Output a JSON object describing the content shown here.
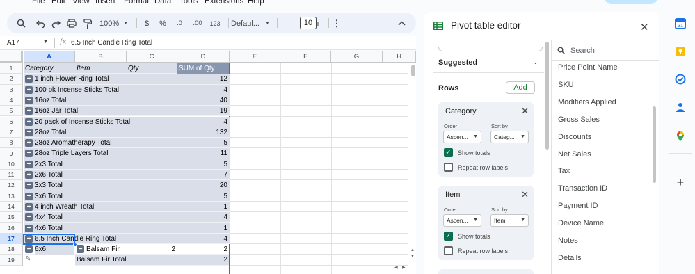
{
  "menu": [
    "File",
    "Edit",
    "View",
    "Insert",
    "Format",
    "Data",
    "Tools",
    "Extensions",
    "Help"
  ],
  "toolbar": {
    "zoom": "100%",
    "currency": "$",
    "percent": "%",
    "dec_decrease": ".0",
    "dec_increase": ".00",
    "number_format": "123",
    "font": "Defaul...",
    "font_size": "10",
    "minus": "–",
    "plus": "+"
  },
  "formula_bar": {
    "cell_ref": "A17",
    "fx": "fx",
    "content": "6.5 Inch Candle Ring Total"
  },
  "columns": [
    "A",
    "B",
    "C",
    "D",
    "E",
    "F",
    "G",
    "H"
  ],
  "row_numbers": [
    "1",
    "2",
    "3",
    "4",
    "5",
    "6",
    "7",
    "8",
    "9",
    "10",
    "11",
    "12",
    "13",
    "14",
    "15",
    "16",
    "17",
    "18",
    "19"
  ],
  "header_row": {
    "category": "Category",
    "item": "Item",
    "qty": "Qty",
    "sum": "SUM of Qty"
  },
  "rows": [
    {
      "label": "1 inch Flower Ring Total",
      "value": "12"
    },
    {
      "label": "100 pk Incense Sticks Total",
      "value": "4"
    },
    {
      "label": "16oz Total",
      "value": "40"
    },
    {
      "label": "16oz Jar Total",
      "value": "19"
    },
    {
      "label": "20 pack of Incense Sticks Total",
      "value": "4"
    },
    {
      "label": "28oz Total",
      "value": "132"
    },
    {
      "label": "28oz Aromatherapy Total",
      "value": "5"
    },
    {
      "label": "28oz Triple Layers Total",
      "value": "11"
    },
    {
      "label": "2x3 Total",
      "value": "5"
    },
    {
      "label": "2x6 Total",
      "value": "7"
    },
    {
      "label": "3x3 Total",
      "value": "20"
    },
    {
      "label": "3x6 Total",
      "value": "5"
    },
    {
      "label": "4 inch Wreath Total",
      "value": "1"
    },
    {
      "label": "4x4 Total",
      "value": "4"
    },
    {
      "label": "4x6 Total",
      "value": "1"
    },
    {
      "label": "6.5 Inch Candle Ring Total",
      "value": "4"
    }
  ],
  "row18": {
    "category": "6x6",
    "item": "Balsam Fir",
    "qty": "2",
    "sum": "2"
  },
  "row19": {
    "item": "Balsam Fir Total",
    "sum": "2"
  },
  "editor": {
    "title": "Pivot table editor",
    "suggested": "Suggested",
    "rows_label": "Rows",
    "add": "Add",
    "cards": [
      {
        "title": "Category",
        "order_label": "Order",
        "sortby_label": "Sort by",
        "order": "Ascen...",
        "sortby": "Categ...",
        "show_totals": "Show totals",
        "repeat": "Repeat row labels"
      },
      {
        "title": "Item",
        "order_label": "Order",
        "sortby_label": "Sort by",
        "order": "Ascen...",
        "sortby": "Item",
        "show_totals": "Show totals",
        "repeat": "Repeat row labels"
      }
    ],
    "search_placeholder": "Search",
    "fields": [
      "Price Point Name",
      "SKU",
      "Modifiers Applied",
      "Gross Sales",
      "Discounts",
      "Net Sales",
      "Tax",
      "Transaction ID",
      "Payment ID",
      "Device Name",
      "Notes",
      "Details"
    ]
  },
  "colors": {
    "accent": "#1a73e8",
    "pivot_row": "#d9dee8",
    "header_cell": "#8896b0",
    "checkbox": "#0b6e4f"
  }
}
